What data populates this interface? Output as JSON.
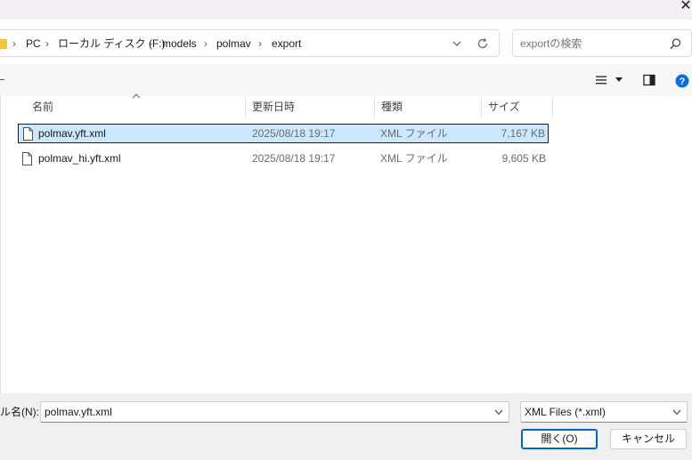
{
  "window": {
    "close_glyph": "✕"
  },
  "address": {
    "crumbs": [
      "PC",
      "ローカル ディスク (F:)",
      "models",
      "polmav",
      "export"
    ],
    "separator": "›"
  },
  "search": {
    "placeholder": "exportの検索"
  },
  "columns": {
    "name": "名前",
    "date": "更新日時",
    "type": "種類",
    "size": "サイズ"
  },
  "files": [
    {
      "name": "polmav.yft.xml",
      "date": "2025/08/18 19:17",
      "type": "XML ファイル",
      "size": "7,167 KB",
      "selected": true
    },
    {
      "name": "polmav_hi.yft.xml",
      "date": "2025/08/18 19:17",
      "type": "XML ファイル",
      "size": "9,605 KB",
      "selected": false
    }
  ],
  "filename": {
    "label": "ル名(N):",
    "value": "polmav.yft.xml"
  },
  "filetype": {
    "value": "XML Files (*.xml)"
  },
  "buttons": {
    "open": "開く(O)",
    "cancel": "キャンセル"
  },
  "colors": {
    "accent": "#0067c0",
    "selection": "#cce8ff",
    "help": "#0a6fd6",
    "folder": "#f2c33e"
  },
  "icons": [
    "close-icon",
    "folder-icon",
    "chevron-down-icon",
    "refresh-icon",
    "search-icon",
    "view-menu-icon",
    "preview-pane-icon",
    "help-icon",
    "sort-up-icon",
    "document-icon"
  ]
}
